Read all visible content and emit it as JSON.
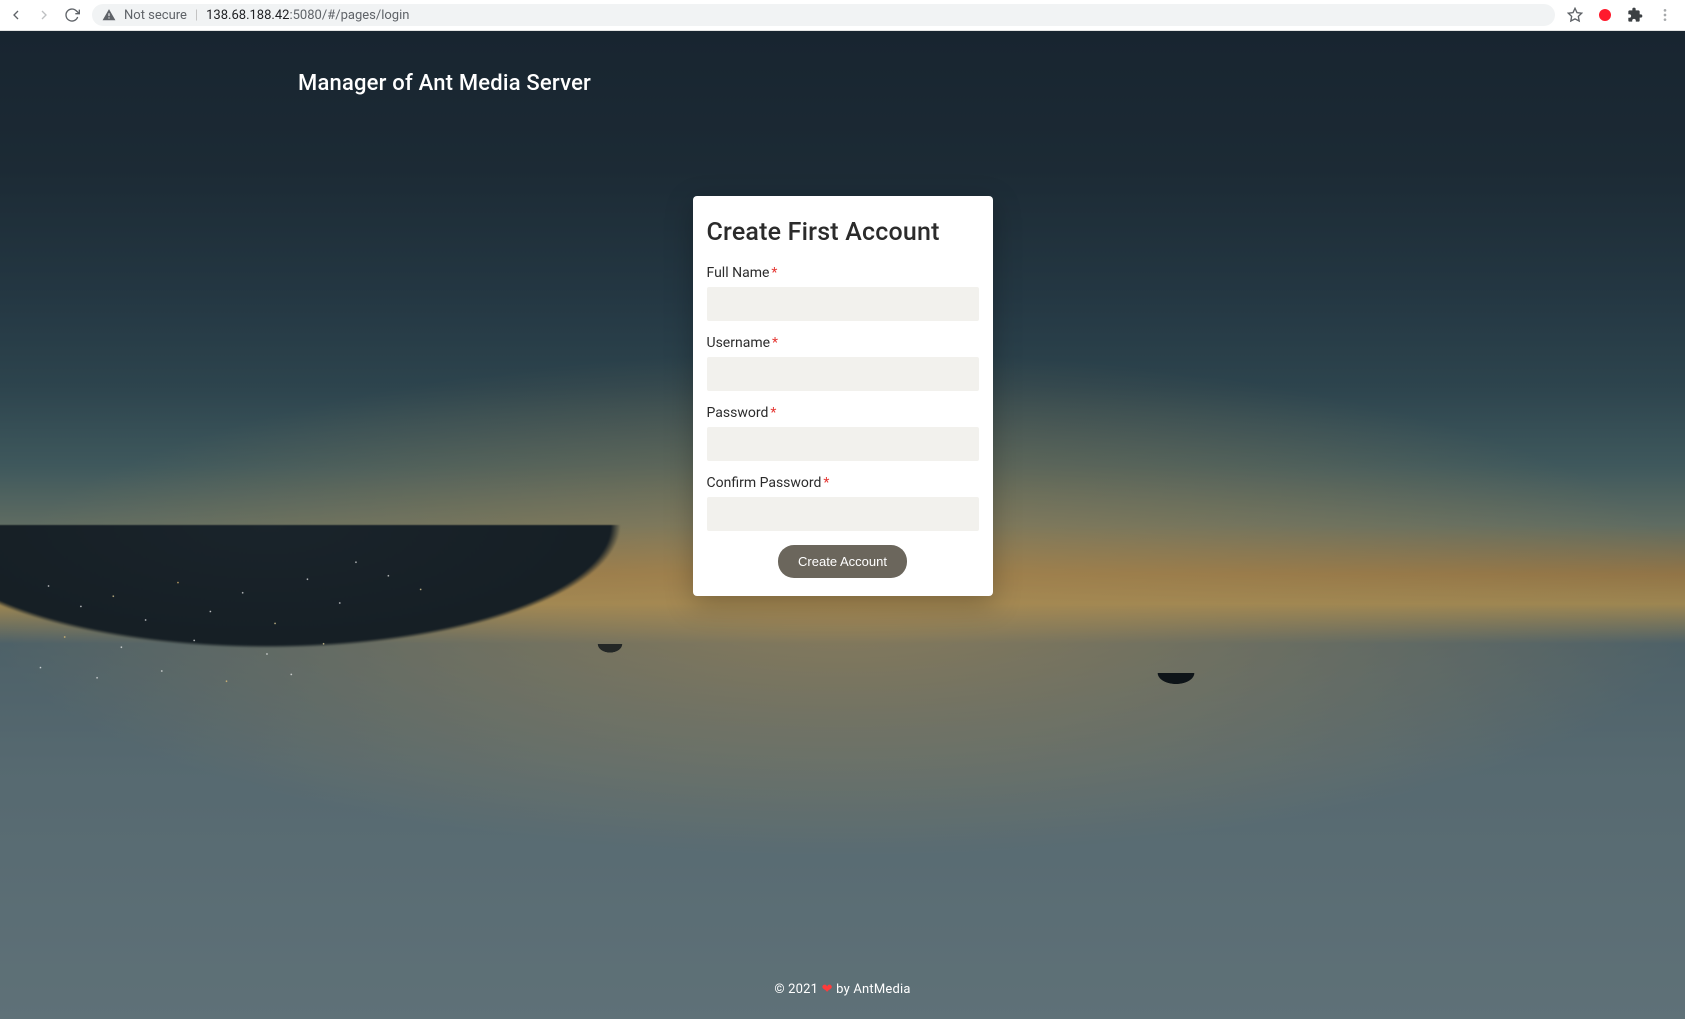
{
  "browser": {
    "security_label": "Not secure",
    "url_host": "138.68.188.42",
    "url_rest": ":5080/#/pages/login"
  },
  "header": {
    "title": "Manager of Ant Media Server"
  },
  "card": {
    "title": "Create First Account",
    "fields": {
      "full_name": {
        "label": "Full Name",
        "value": ""
      },
      "username": {
        "label": "Username",
        "value": ""
      },
      "password": {
        "label": "Password",
        "value": ""
      },
      "confirm": {
        "label": "Confirm Password",
        "value": ""
      }
    },
    "required_mark": "*",
    "submit_label": "Create Account"
  },
  "footer": {
    "copyright_prefix": "© 2021",
    "by_text": "by AntMedia"
  }
}
